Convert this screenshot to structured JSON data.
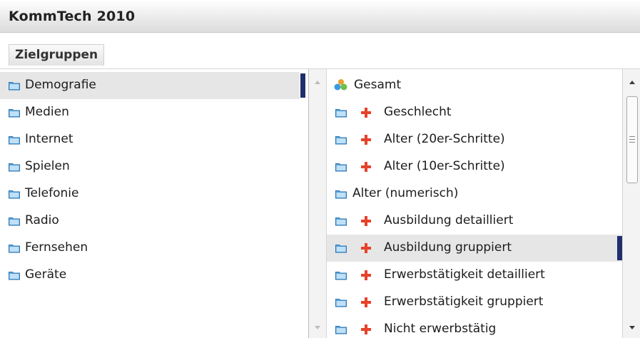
{
  "app": {
    "title": "KommTech 2010"
  },
  "tabs": [
    {
      "label": "Zielgruppen"
    }
  ],
  "left_list": [
    {
      "label": "Demografie",
      "icon": "folder-icon",
      "selected": true
    },
    {
      "label": "Medien",
      "icon": "folder-icon"
    },
    {
      "label": "Internet",
      "icon": "folder-icon"
    },
    {
      "label": "Spielen",
      "icon": "folder-icon"
    },
    {
      "label": "Telefonie",
      "icon": "folder-icon"
    },
    {
      "label": "Radio",
      "icon": "folder-icon"
    },
    {
      "label": "Fernsehen",
      "icon": "folder-icon"
    },
    {
      "label": "Geräte",
      "icon": "folder-icon"
    }
  ],
  "right_list": [
    {
      "label": "Gesamt",
      "icon": "group-icon"
    },
    {
      "label": "Geschlecht",
      "icon": "folder-icon",
      "expandable": true
    },
    {
      "label": "Alter (20er-Schritte)",
      "icon": "folder-icon",
      "expandable": true
    },
    {
      "label": "Alter (10er-Schritte)",
      "icon": "folder-icon",
      "expandable": true
    },
    {
      "label": "Alter (numerisch)",
      "icon": "folder-icon"
    },
    {
      "label": "Ausbildung detailliert",
      "icon": "folder-icon",
      "expandable": true
    },
    {
      "label": "Ausbildung gruppiert",
      "icon": "folder-icon",
      "expandable": true,
      "selected": true
    },
    {
      "label": "Erwerbstätigkeit detailliert",
      "icon": "folder-icon",
      "expandable": true
    },
    {
      "label": "Erwerbstätigkeit gruppiert",
      "icon": "folder-icon",
      "expandable": true
    },
    {
      "label": "Nicht erwerbstätig",
      "icon": "folder-icon",
      "expandable": true
    }
  ],
  "colors": {
    "selection_marker": "#1f2f6e",
    "plus": "#e8412a",
    "folder": "#5aa6dc"
  }
}
